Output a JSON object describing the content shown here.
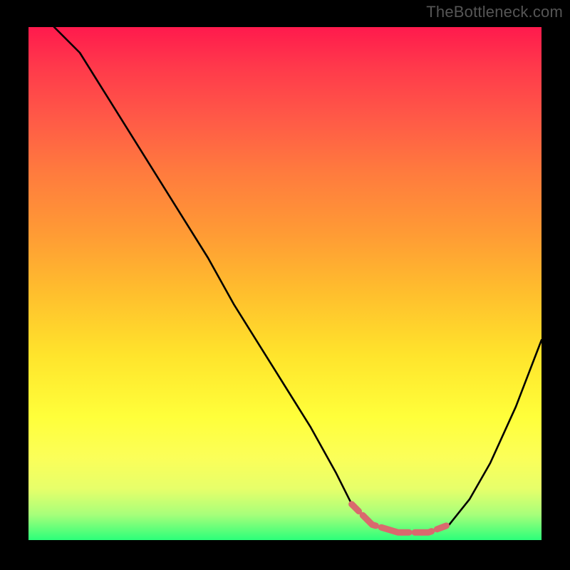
{
  "watermark": "TheBottleneck.com",
  "chart_data": {
    "type": "line",
    "title": "",
    "xlabel": "",
    "ylabel": "",
    "xlim": [
      0,
      1
    ],
    "ylim": [
      0,
      1
    ],
    "background_gradient": {
      "top_color": "#ff1a4d",
      "bottom_color": "#2bff7a"
    },
    "series": [
      {
        "name": "main-curve",
        "color": "#000000",
        "x": [
          0.05,
          0.1,
          0.15,
          0.2,
          0.25,
          0.3,
          0.35,
          0.4,
          0.45,
          0.5,
          0.55,
          0.6,
          0.63,
          0.67,
          0.72,
          0.78,
          0.82,
          0.86,
          0.9,
          0.95,
          1.0
        ],
        "y": [
          1.0,
          0.95,
          0.87,
          0.79,
          0.71,
          0.63,
          0.55,
          0.46,
          0.38,
          0.3,
          0.22,
          0.13,
          0.07,
          0.03,
          0.015,
          0.015,
          0.03,
          0.08,
          0.15,
          0.26,
          0.39
        ]
      },
      {
        "name": "highlight-segment",
        "color": "#d9696e",
        "x": [
          0.63,
          0.67,
          0.72,
          0.78,
          0.82
        ],
        "y": [
          0.07,
          0.03,
          0.015,
          0.015,
          0.03
        ]
      }
    ]
  }
}
